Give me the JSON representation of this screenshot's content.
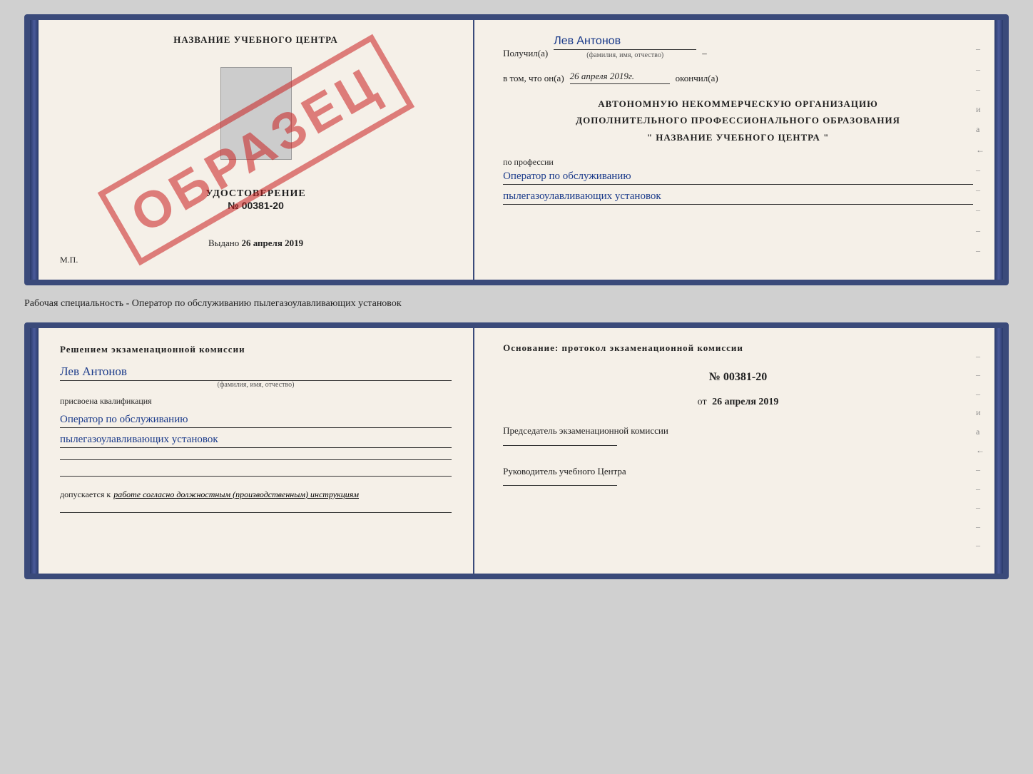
{
  "page": {
    "background_color": "#d0d0d0"
  },
  "certificate": {
    "left": {
      "title": "НАЗВАНИЕ УЧЕБНОГО ЦЕНТРА",
      "watermark": "ОБРАЗЕЦ",
      "type_label": "УДОСТОВЕРЕНИЕ",
      "number": "№ 00381-20",
      "issued_label": "Выдано",
      "issued_date": "26 апреля 2019",
      "mp_label": "М.П."
    },
    "right": {
      "received_prefix": "Получил(а)",
      "recipient_name": "Лев Антонов",
      "recipient_sub": "(фамилия, имя, отчество)",
      "date_prefix": "в том, что он(а)",
      "date_value": "26 апреля 2019г.",
      "date_suffix": "окончил(а)",
      "org_line1": "АВТОНОМНУЮ НЕКОММЕРЧЕСКУЮ ОРГАНИЗАЦИЮ",
      "org_line2": "ДОПОЛНИТЕЛЬНОГО ПРОФЕССИОНАЛЬНОГО ОБРАЗОВАНИЯ",
      "org_line3": "\"   НАЗВАНИЕ УЧЕБНОГО ЦЕНТРА   \"",
      "profession_label": "по профессии",
      "profession_line1": "Оператор по обслуживанию",
      "profession_line2": "пылегазоулавливающих установок"
    }
  },
  "separator": {
    "text": "Рабочая специальность - Оператор по обслуживанию пылегазоулавливающих установок"
  },
  "qualification": {
    "left": {
      "section_title": "Решением экзаменационной комиссии",
      "person_name": "Лев Антонов",
      "person_sub": "(фамилия, имя, отчество)",
      "assigned_label": "присвоена квалификация",
      "qual_line1": "Оператор по обслуживанию",
      "qual_line2": "пылегазоулавливающих установок",
      "допуск_prefix": "допускается к",
      "допуск_italic": "работе согласно должностным (производственным) инструкциям"
    },
    "right": {
      "osnov_label": "Основание: протокол экзаменационной комиссии",
      "protocol_number": "№ 00381-20",
      "protocol_date_prefix": "от",
      "protocol_date": "26 апреля 2019",
      "chairman_label": "Председатель экзаменационной комиссии",
      "director_label": "Руководитель учебного Центра"
    }
  },
  "decorations": {
    "dashes": [
      "-",
      "-",
      "-",
      "и",
      "а",
      "←",
      "-",
      "-",
      "-",
      "-",
      "-"
    ]
  }
}
